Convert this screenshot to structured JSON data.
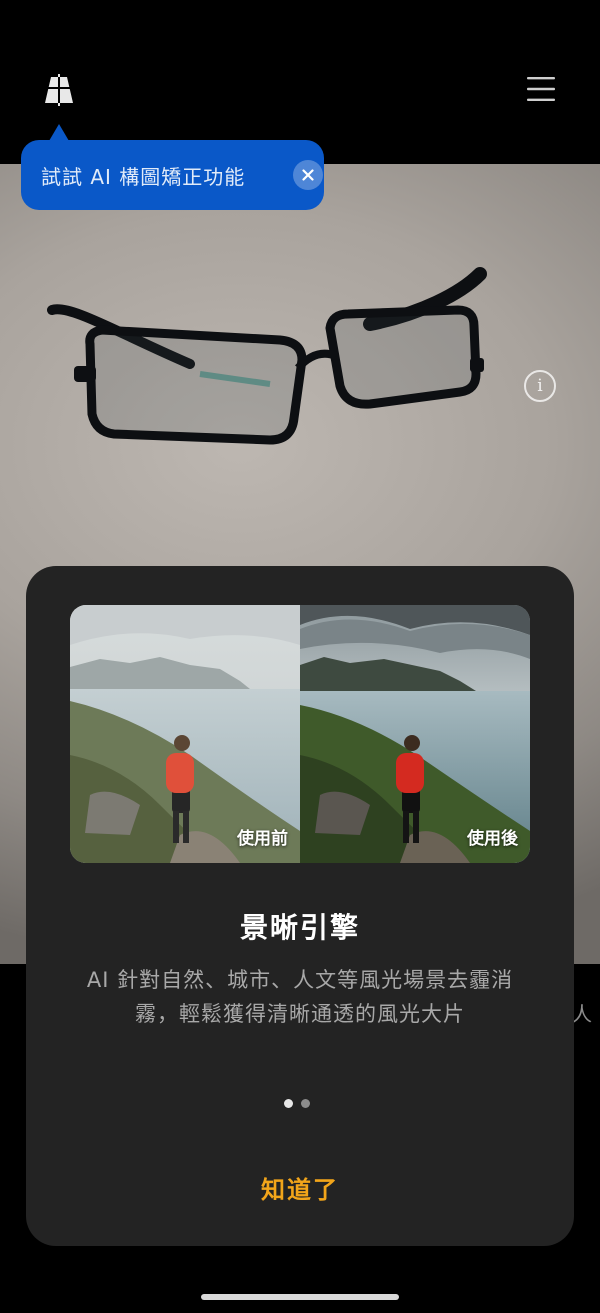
{
  "top_bar": {
    "grid_icon": "composition-grid-icon",
    "menu_icon": "hamburger-menu-icon"
  },
  "tooltip": {
    "text": "試試 AI 構圖矯正功能",
    "close_icon": "close-icon"
  },
  "viewfinder": {
    "info_label": "i",
    "info_icon": "info-icon",
    "edge_text": "人"
  },
  "sheet": {
    "before_label": "使用前",
    "after_label": "使用後",
    "title": "景晰引擎",
    "description": "AI 針對自然、城市、人文等風光場景去霾消霧，輕鬆獲得清晰通透的風光大片",
    "page_indicator": {
      "total": 2,
      "current": 1
    },
    "confirm_label": "知道了"
  },
  "colors": {
    "tooltip_bg": "#0a58c8",
    "accent": "#f2a51a",
    "sheet_bg": "#232323",
    "status_dot": "#30d158"
  }
}
